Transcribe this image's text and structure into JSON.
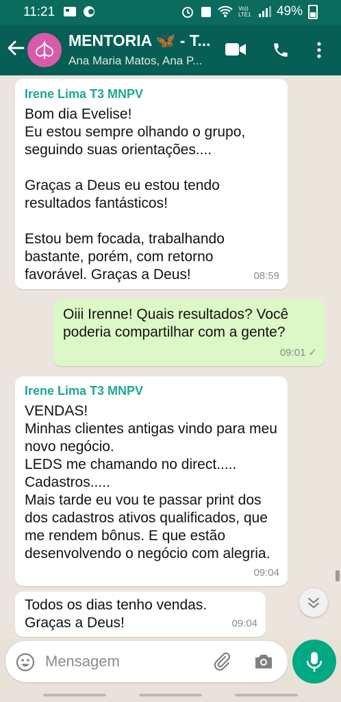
{
  "status_bar": {
    "time": "11:21",
    "lte_label": "Vo)) LTE1",
    "battery": "49%"
  },
  "header": {
    "title": "MENTORIA 🦋 - T...",
    "subtitle": "Ana Maria Matos, Ana P..."
  },
  "messages": [
    {
      "direction": "incoming",
      "sender": "Irene Lima T3 MNPV",
      "text": "Bom dia Evelise!\nEu estou sempre olhando o grupo, seguindo suas orientações....\n\nGraças a Deus eu estou tendo resultados fantásticos!\n\nEstou bem focada, trabalhando bastante, porém,  com retorno favorável.  Graças a Deus!",
      "time": "08:59"
    },
    {
      "direction": "outgoing",
      "text": "Oiii Irenne! Quais resultados? Você poderia compartilhar com a gente?",
      "time": "09:01",
      "status": "✓"
    },
    {
      "direction": "incoming",
      "sender": "Irene Lima T3 MNPV",
      "text": "VENDAS!\nMinhas clientes antigas vindo para meu novo negócio.\nLEDS me chamando no direct.....\nCadastros.....\nMais tarde eu vou te passar print dos dos cadastros ativos qualificados, que me rendem bônus.  E que estão desenvolvendo o negócio com alegria.",
      "time": "09:04"
    },
    {
      "direction": "incoming",
      "text": "Todos os dias tenho vendas.\nGraças a Deus!",
      "time": "09:04"
    }
  ],
  "composer": {
    "placeholder": "Mensagem"
  },
  "colors": {
    "header": "#075e54",
    "status_bar": "#0b6b5c",
    "outgoing_bubble": "#dcf8c6",
    "incoming_bubble": "#ffffff",
    "sender_name": "#1ea892",
    "mic_button": "#00a884"
  },
  "icons": [
    "back-arrow-icon",
    "video-call-icon",
    "phone-icon",
    "more-options-icon",
    "emoji-icon",
    "attach-icon",
    "camera-icon",
    "mic-icon",
    "scroll-down-icon"
  ]
}
